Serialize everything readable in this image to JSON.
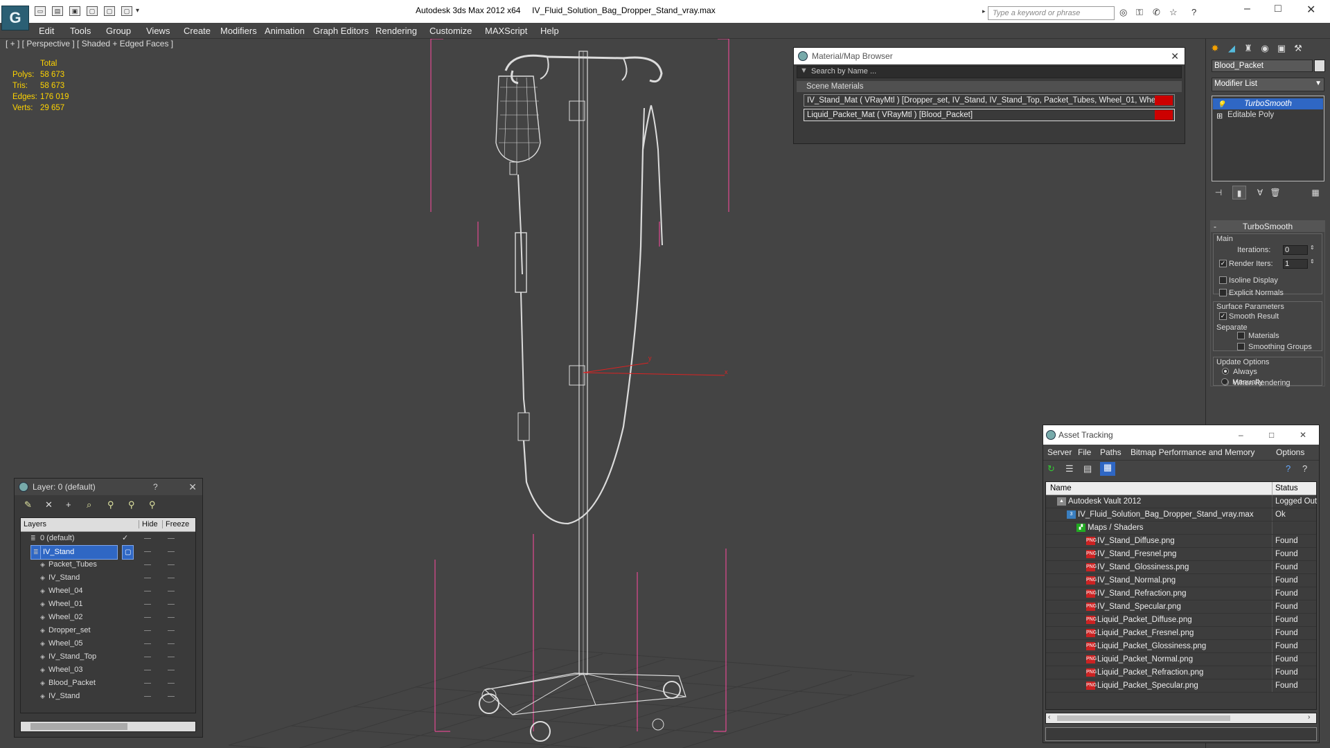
{
  "app": {
    "title": "Autodesk 3ds Max  2012 x64",
    "file": "IV_Fluid_Solution_Bag_Dropper_Stand_vray.max",
    "search_placeholder": "Type a keyword or phrase",
    "logo_glyph": "G"
  },
  "menubar": [
    "Edit",
    "Tools",
    "Group",
    "Views",
    "Create",
    "Modifiers",
    "Animation",
    "Graph Editors",
    "Rendering",
    "Customize",
    "MAXScript",
    "Help"
  ],
  "viewport": {
    "label": "[ + ] [ Perspective ] [ Shaded + Edged Faces ]",
    "stats": {
      "header": "Total",
      "rows": [
        {
          "label": "Polys:",
          "value": "58 673"
        },
        {
          "label": "Tris:",
          "value": "58 673"
        },
        {
          "label": "Edges:",
          "value": "176 019"
        },
        {
          "label": "Verts:",
          "value": "29 657"
        }
      ]
    },
    "axis_x": "x",
    "axis_y": "y"
  },
  "material_browser": {
    "title": "Material/Map Browser",
    "search_placeholder": "Search by Name ...",
    "group": "Scene Materials",
    "materials": [
      "IV_Stand_Mat  ( VRayMtl )  [Dropper_set, IV_Stand, IV_Stand_Top, Packet_Tubes, Wheel_01, Wheel_...",
      "Liquid_Packet_Mat  ( VRayMtl )  [Blood_Packet]"
    ],
    "swatch_color": "#c40000"
  },
  "command_panel": {
    "object_name": "Blood_Packet",
    "modifier_list": "Modifier List",
    "stack": [
      "TurboSmooth",
      "Editable Poly"
    ],
    "turbosmooth": {
      "title": "TurboSmooth",
      "main": "Main",
      "iterations_label": "Iterations:",
      "iterations": "0",
      "render_iters_label": "Render Iters:",
      "render_iters": "1",
      "isoline": "Isoline Display",
      "explicit": "Explicit Normals",
      "surface_params": "Surface Parameters",
      "smooth_result": "Smooth Result",
      "separate": "Separate",
      "materials": "Materials",
      "smoothing_groups": "Smoothing Groups",
      "update_options": "Update Options",
      "always": "Always",
      "when_rendering": "When Rendering",
      "manually": "Manually"
    }
  },
  "layer_dialog": {
    "title": "Layer: 0 (default)",
    "help": "?",
    "columns": {
      "layers": "Layers",
      "hide": "Hide",
      "freeze": "Freeze"
    },
    "rows": [
      {
        "name": "0 (default)",
        "level": 0
      },
      {
        "name": "IV_Stand",
        "level": 0
      },
      {
        "name": "Packet_Tubes",
        "level": 1
      },
      {
        "name": "IV_Stand",
        "level": 1
      },
      {
        "name": "Wheel_04",
        "level": 1
      },
      {
        "name": "Wheel_01",
        "level": 1
      },
      {
        "name": "Wheel_02",
        "level": 1
      },
      {
        "name": "Dropper_set",
        "level": 1
      },
      {
        "name": "Wheel_05",
        "level": 1
      },
      {
        "name": "IV_Stand_Top",
        "level": 1
      },
      {
        "name": "Wheel_03",
        "level": 1
      },
      {
        "name": "Blood_Packet",
        "level": 1
      },
      {
        "name": "IV_Stand",
        "level": 1
      }
    ]
  },
  "asset_tracking": {
    "title": "Asset Tracking",
    "menu": [
      "Server",
      "File",
      "Paths",
      "Bitmap Performance and Memory",
      "Options"
    ],
    "columns": {
      "name": "Name",
      "status": "Status"
    },
    "rows": [
      {
        "name": "Autodesk Vault 2012",
        "status": "Logged Out",
        "level": 0,
        "icon": "vault"
      },
      {
        "name": "IV_Fluid_Solution_Bag_Dropper_Stand_vray.max",
        "status": "Ok",
        "level": 1,
        "icon": "max"
      },
      {
        "name": "Maps / Shaders",
        "status": "",
        "level": 2,
        "icon": "maps"
      },
      {
        "name": "IV_Stand_Diffuse.png",
        "status": "Found",
        "level": 3,
        "icon": "png"
      },
      {
        "name": "IV_Stand_Fresnel.png",
        "status": "Found",
        "level": 3,
        "icon": "png"
      },
      {
        "name": "IV_Stand_Glossiness.png",
        "status": "Found",
        "level": 3,
        "icon": "png"
      },
      {
        "name": "IV_Stand_Normal.png",
        "status": "Found",
        "level": 3,
        "icon": "png"
      },
      {
        "name": "IV_Stand_Refraction.png",
        "status": "Found",
        "level": 3,
        "icon": "png"
      },
      {
        "name": "IV_Stand_Specular.png",
        "status": "Found",
        "level": 3,
        "icon": "png"
      },
      {
        "name": "Liquid_Packet_Diffuse.png",
        "status": "Found",
        "level": 3,
        "icon": "png"
      },
      {
        "name": "Liquid_Packet_Fresnel.png",
        "status": "Found",
        "level": 3,
        "icon": "png"
      },
      {
        "name": "Liquid_Packet_Glossiness.png",
        "status": "Found",
        "level": 3,
        "icon": "png"
      },
      {
        "name": "Liquid_Packet_Normal.png",
        "status": "Found",
        "level": 3,
        "icon": "png"
      },
      {
        "name": "Liquid_Packet_Refraction.png",
        "status": "Found",
        "level": 3,
        "icon": "png"
      },
      {
        "name": "Liquid_Packet_Specular.png",
        "status": "Found",
        "level": 3,
        "icon": "png"
      }
    ]
  },
  "colors": {
    "selection": "#2f67c4",
    "stats": "#ffd400",
    "bbox": "#ff4aa0"
  }
}
